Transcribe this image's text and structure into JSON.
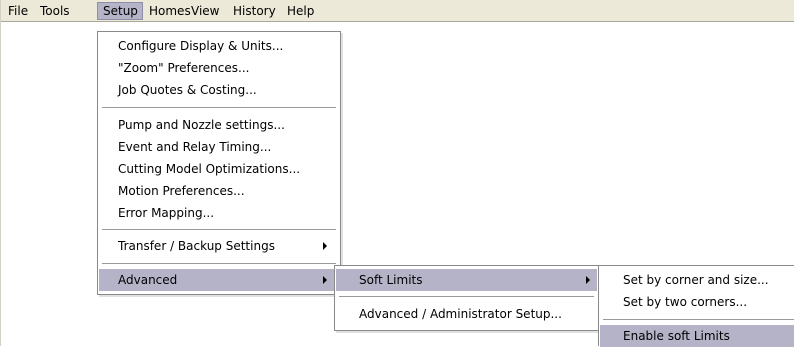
{
  "menubar": {
    "items": [
      "File",
      "Tools",
      "Setup",
      "Homes",
      "View",
      "History",
      "Help"
    ]
  },
  "setup_menu": {
    "items": [
      "Configure Display & Units...",
      "\"Zoom\" Preferences...",
      "Job Quotes & Costing...",
      "Pump and Nozzle settings...",
      "Event and Relay Timing...",
      "Cutting Model Optimizations...",
      "Motion Preferences...",
      "Error Mapping...",
      "Transfer / Backup Settings",
      "Advanced"
    ]
  },
  "advanced_menu": {
    "items": [
      "Soft Limits",
      "Advanced / Administrator Setup..."
    ]
  },
  "soft_limits_menu": {
    "items": [
      "Set by corner and size...",
      "Set by two corners...",
      "Enable soft Limits"
    ]
  },
  "colors": {
    "menubar_bg": "#ece9d8",
    "highlight": "#b5b3c8"
  }
}
